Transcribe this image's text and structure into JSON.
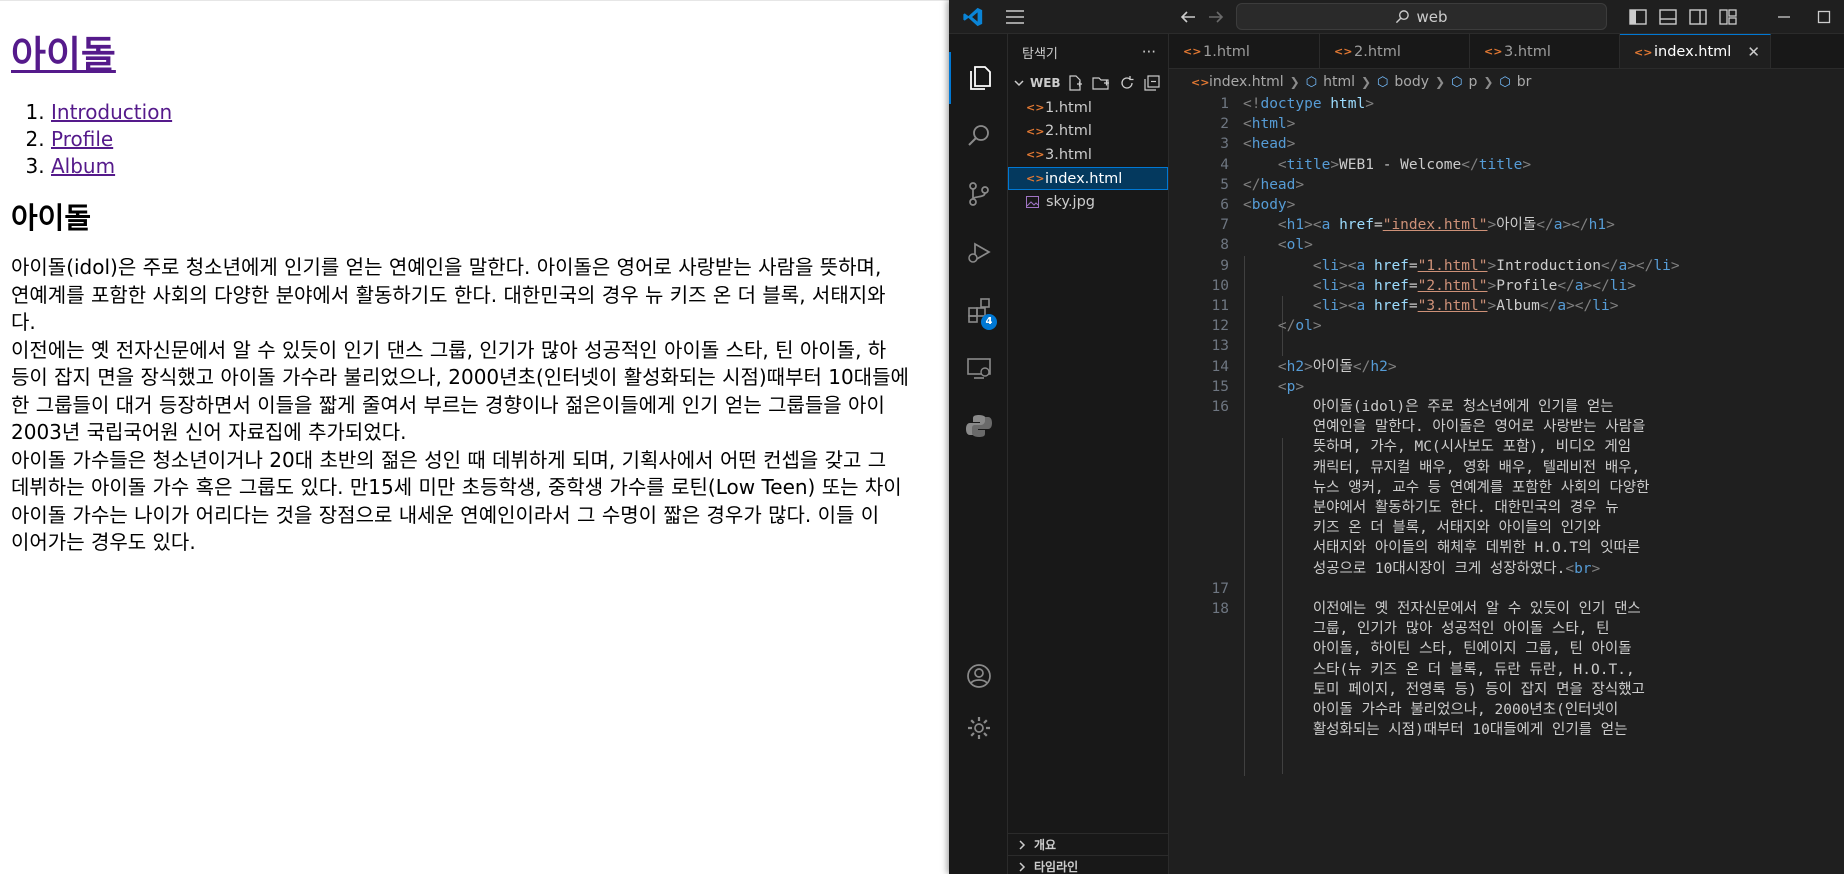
{
  "browser_page": {
    "h1_link": "아이돌",
    "nav": [
      "Introduction",
      "Profile",
      "Album"
    ],
    "h2": "아이돌",
    "paragraph_lines": [
      "아이돌(idol)은 주로 청소년에게 인기를 얻는 연예인을 말한다. 아이돌은 영어로 사랑받는 사람을 뜻하며,",
      "연예계를 포함한 사회의 다양한 분야에서 활동하기도 한다. 대한민국의 경우 뉴 키즈 온 더 블록, 서태지와",
      "다.",
      "이전에는 옛 전자신문에서 알 수 있듯이 인기 댄스 그룹, 인기가 많아 성공적인 아이돌 스타, 틴 아이돌, 하",
      "등이 잡지 면을 장식했고 아이돌 가수라 불리었으나, 2000년초(인터넷이 활성화되는 시점)때부터 10대들에",
      "한 그룹들이 대거 등장하면서 이들을 짧게 줄여서 부르는 경향이나 젊은이들에게 인기 얻는 그룹들을 아이",
      "2003년 국립국어원 신어 자료집에 추가되었다.",
      "아이돌 가수들은 청소년이거나 20대 초반의 젊은 성인 때 데뷔하게 되며, 기획사에서 어떤 컨셉을 갖고 그",
      "데뷔하는 아이돌 가수 혹은 그룹도 있다. 만15세 미만 초등학생, 중학생 가수를 로틴(Low Teen) 또는 차이",
      "아이돌 가수는 나이가 어리다는 것을 장점으로 내세운 연예인이라서 그 수명이 짧은 경우가 많다. 이들 이",
      "이어가는 경우도 있다."
    ]
  },
  "vscode": {
    "search_text": "web",
    "explorer": {
      "title": "탐색기",
      "more": "···",
      "folder": "WEB",
      "files": [
        "1.html",
        "2.html",
        "3.html",
        "index.html",
        "sky.jpg"
      ],
      "selected_file": "index.html",
      "outline_label": "개요",
      "timeline_label": "타임라인"
    },
    "extensions_badge": "4",
    "tabs": [
      "1.html",
      "2.html",
      "3.html",
      "index.html"
    ],
    "active_tab": "index.html",
    "breadcrumb": [
      "index.html",
      "html",
      "body",
      "p",
      "br"
    ],
    "line_numbers": [
      "1",
      "2",
      "3",
      "4",
      "5",
      "6",
      "7",
      "8",
      "9",
      "10",
      "11",
      "12",
      "13",
      "14",
      "15",
      "16",
      "17",
      "18"
    ],
    "code": {
      "l1a": "<!",
      "l1b": "doctype",
      "l1c": " html",
      "l1d": ">",
      "html_open": "html",
      "head_open": "head",
      "title_tag": "title",
      "title_text": "WEB1 - Welcome",
      "head_close": "head",
      "body_open": "body",
      "h1": "h1",
      "a": "a",
      "href": "href",
      "index_href": "\"index.html\"",
      "h1_text": "아이돌",
      "ol": "ol",
      "li": "li",
      "href1": "\"1.html\"",
      "href2": "\"2.html\"",
      "href3": "\"3.html\"",
      "li1_text": "Introduction",
      "li2_text": "Profile",
      "li3_text": "Album",
      "h2": "h2",
      "h2_text": "아이돌",
      "p": "p",
      "br": "br",
      "p16_lines": [
        "아이돌(idol)은 주로 청소년에게 인기를 얻는",
        "연예인을 말한다. 아이돌은 영어로 사랑받는 사람을",
        "뜻하며, 가수, MC(시사보도 포함), 비디오 게임",
        "캐릭터, 뮤지컬 배우, 영화 배우, 텔레비전 배우,",
        "뉴스 앵커, 교수 등 연예계를 포함한 사회의 다양한",
        "분야에서 활동하기도 한다. 대한민국의 경우 뉴",
        "키즈 온 더 블록, 서태지와 아이들의 인기와",
        "서태지와 아이들의 해체후 데뷔한 H.O.T의 잇따른",
        "성공으로 10대시장이 크게 성장하였다."
      ],
      "p18_lines": [
        "이전에는 옛 전자신문에서 알 수 있듯이 인기 댄스",
        "그룹, 인기가 많아 성공적인 아이돌 스타, 틴",
        "아이돌, 하이틴 스타, 틴에이지 그룹, 틴 아이돌",
        "스타(뉴 키즈 온 더 블록, 듀란 듀란, H.O.T.,",
        "토미 페이지, 전영록 등) 등이 잡지 면을 장식했고",
        "아이돌 가수라 불리었으나, 2000년초(인터넷이",
        "활성화되는 시점)때부터 10대들에게 인기를 얻는"
      ]
    }
  }
}
